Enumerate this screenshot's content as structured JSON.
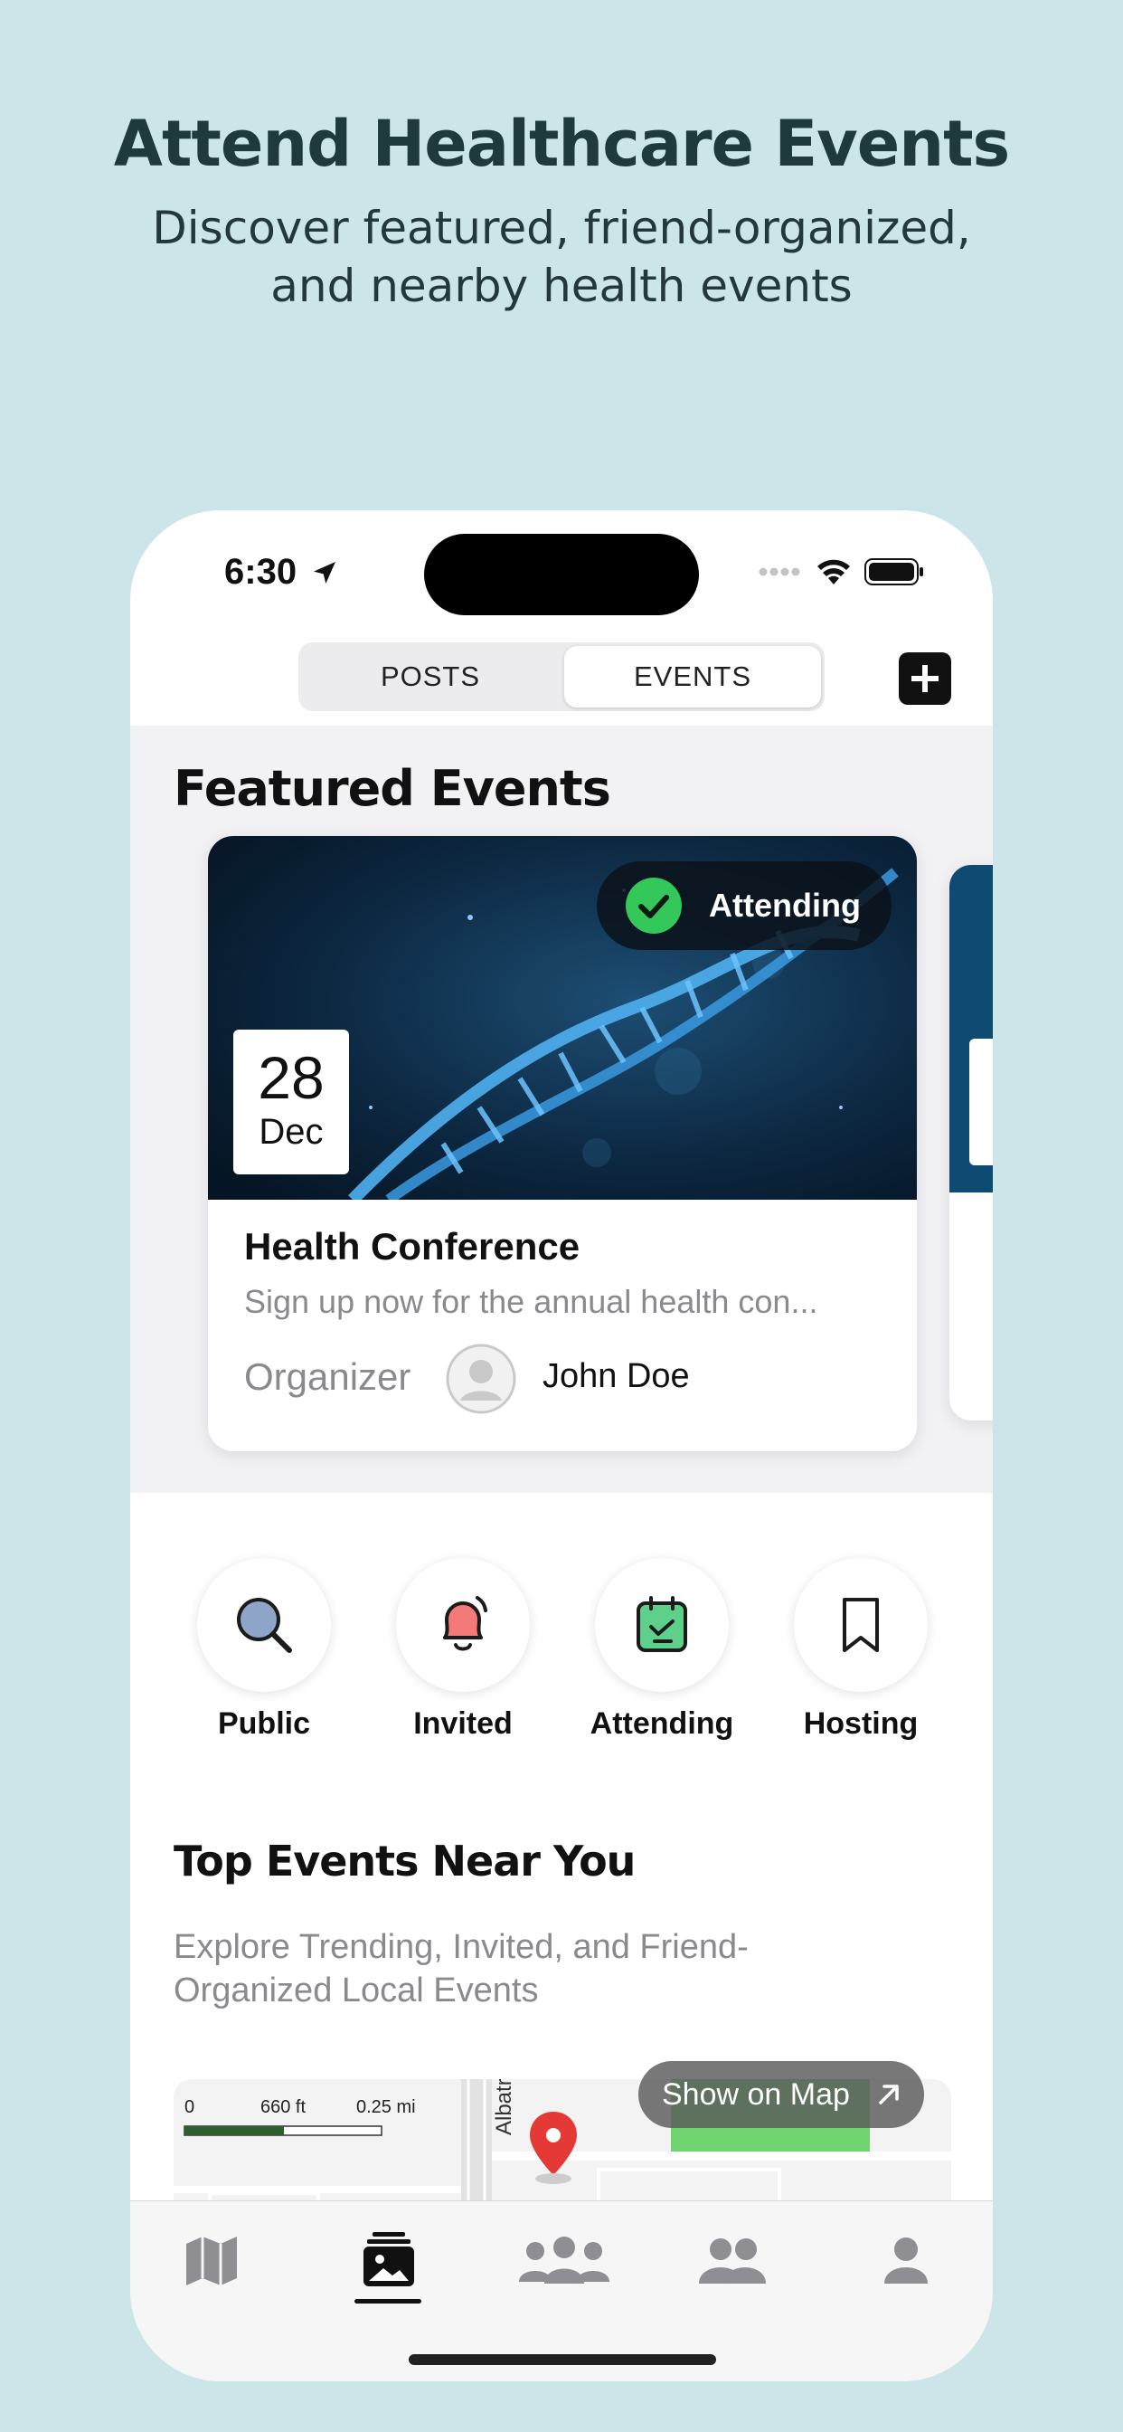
{
  "promo": {
    "headline": "Attend Healthcare Events",
    "subhead": "Discover featured, friend-organized, and nearby health events"
  },
  "status_bar": {
    "time": "6:30",
    "icons": [
      "location-arrow-icon",
      "signal-icon",
      "wifi-icon",
      "battery-icon"
    ]
  },
  "segment": {
    "posts_label": "POSTS",
    "events_label": "EVENTS",
    "selected": "EVENTS"
  },
  "featured": {
    "title": "Featured Events",
    "card": {
      "status_label": "Attending",
      "date_day": "28",
      "date_month": "Dec",
      "title": "Health Conference",
      "description": "Sign up now for the annual health con...",
      "organizer_label": "Organizer",
      "organizer_name": "John Doe"
    }
  },
  "categories": [
    {
      "label": "Public",
      "icon": "search-icon"
    },
    {
      "label": "Invited",
      "icon": "bell-icon"
    },
    {
      "label": "Attending",
      "icon": "calendar-check-icon"
    },
    {
      "label": "Hosting",
      "icon": "bookmark-icon"
    }
  ],
  "nearby": {
    "title": "Top Events Near You",
    "description": "Explore Trending, Invited, and Friend-Organized Local Events",
    "map_button": "Show on Map",
    "map_scale": [
      "0",
      "660 ft",
      "0.25 mi"
    ],
    "street_label": "Albatross"
  },
  "tabbar": {
    "tabs": [
      "map-icon",
      "events-icon",
      "groups-icon",
      "friends-icon",
      "profile-icon"
    ],
    "selected": "events-icon"
  },
  "colors": {
    "background": "#cbe5e8",
    "attending_green": "#34c759",
    "bell_red": "#f47a7a",
    "calendar_green": "#5fcf8c",
    "search_blue": "#8ea4c9",
    "map_green": "#6fd36f",
    "pin_red": "#e53935"
  }
}
